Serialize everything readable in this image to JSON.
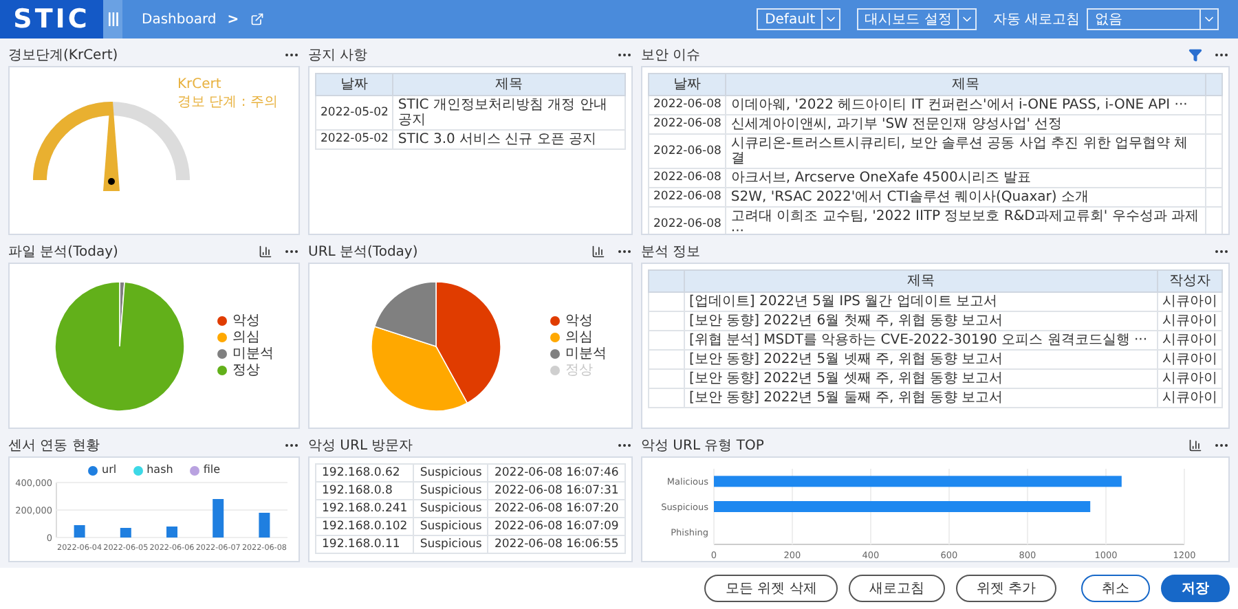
{
  "header": {
    "logo": "STIC",
    "breadcrumb": "Dashboard",
    "separator": ">",
    "dashboard_select": "Default",
    "settings_menu": "대시보드 설정",
    "auto_refresh_label": "자동 새로고침",
    "auto_refresh_select": "없음"
  },
  "panels": [
    {
      "kind": "gauge",
      "title": "경보단계(KrCert)",
      "source": "KrCert",
      "status": "경보 단계 : 주의",
      "level": 0.5
    },
    {
      "kind": "table",
      "title": "공지 사항",
      "columns": [
        "날짜",
        "제목"
      ],
      "rows": [
        [
          "2022-05-02",
          "STIC 개인정보처리방침 개정 안내 공지"
        ],
        [
          "2022-05-02",
          "STIC 3.0 서비스 신규 오픈 공지"
        ]
      ]
    },
    {
      "kind": "table",
      "title": "보안 이슈",
      "filter": true,
      "columns": [
        "날짜",
        "제목",
        ""
      ],
      "rows": [
        [
          "2022-06-08",
          "이데아웨, '2022 헤드아이티 IT 컨퍼런스'에서 i-ONE PASS, i-ONE API ···",
          ""
        ],
        [
          "2022-06-08",
          "신세계아이앤씨, 과기부 'SW 전문인재 양성사업' 선정",
          ""
        ],
        [
          "2022-06-08",
          "시큐리온-트러스트시큐리티, 보안 솔루션 공동 사업 추진 위한 업무협약 체결",
          ""
        ],
        [
          "2022-06-08",
          "아크서브, Arcserve OneXafe 4500시리즈 발표",
          ""
        ],
        [
          "2022-06-08",
          "S2W, 'RSAC 2022'에서 CTI솔루션 퀘이사(Quaxar) 소개",
          ""
        ],
        [
          "2022-06-08",
          "고려대 이희조 교수팀, '2022 IITP 정보보호 R&D과제교류회' 우수성과 과제···",
          ""
        ]
      ]
    },
    {
      "kind": "pie",
      "title": "파일 분석(Today)",
      "chart_toggle": true,
      "legend": [
        {
          "label": "악성",
          "color": "#e03c00",
          "hidden": false
        },
        {
          "label": "의심",
          "color": "#ffa800",
          "hidden": false
        },
        {
          "label": "미분석",
          "color": "#808080",
          "hidden": false
        },
        {
          "label": "정상",
          "color": "#62b01a",
          "hidden": false
        }
      ]
    },
    {
      "kind": "pie",
      "title": "URL 분석(Today)",
      "chart_toggle": true,
      "legend": [
        {
          "label": "악성",
          "color": "#e03c00",
          "hidden": false
        },
        {
          "label": "의심",
          "color": "#ffa800",
          "hidden": false
        },
        {
          "label": "미분석",
          "color": "#808080",
          "hidden": false
        },
        {
          "label": "정상",
          "color": "#cfcfcf",
          "hidden": true
        }
      ]
    },
    {
      "kind": "table",
      "title": "분석 정보",
      "columns": [
        "",
        "제목",
        "작성자"
      ],
      "rows": [
        [
          "",
          "[업데이트] 2022년 5월 IPS 월간 업데이트 보고서",
          "시큐아이"
        ],
        [
          "",
          "[보안 동향] 2022년 6월 첫째 주, 위협 동향 보고서",
          "시큐아이"
        ],
        [
          "",
          "[위협 분석] MSDT를 악용하는 CVE-2022-30190 오피스 원격코드실행 ···",
          "시큐아이"
        ],
        [
          "",
          "[보안 동향] 2022년 5월 넷째 주, 위협 동향 보고서",
          "시큐아이"
        ],
        [
          "",
          "[보안 동향] 2022년 5월 셋째 주, 위협 동향 보고서",
          "시큐아이"
        ],
        [
          "",
          "[보안 동향] 2022년 5월 둘째 주, 위협 동향 보고서",
          "시큐아이"
        ]
      ]
    },
    {
      "kind": "chart",
      "title": "센서 연동 현황",
      "chart_data": {
        "type": "bar",
        "orientation": "vertical",
        "grid": true,
        "categories": [
          "2022-06-04",
          "2022-06-05",
          "2022-06-06",
          "2022-06-07",
          "2022-06-08"
        ],
        "series": [
          {
            "name": "url",
            "color": "#1f7fe0",
            "values": [
              90000,
              70000,
              80000,
              280000,
              180000
            ]
          },
          {
            "name": "hash",
            "color": "#3dd8e6",
            "values": [
              null,
              null,
              null,
              null,
              null
            ]
          },
          {
            "name": "file",
            "color": "#b9a2e0",
            "values": [
              null,
              null,
              null,
              null,
              null
            ]
          }
        ],
        "ylim": [
          0,
          400000
        ],
        "yticks": [
          0,
          {
            "value": 200000,
            "label": "200,000"
          },
          {
            "value": 400000,
            "label": "400,000"
          }
        ]
      }
    },
    {
      "kind": "list",
      "title": "악성 URL 방문자",
      "rows": [
        [
          "192.168.0.62",
          "Suspicious",
          "2022-06-08 16:07:46"
        ],
        [
          "192.168.0.8",
          "Suspicious",
          "2022-06-08 16:07:31"
        ],
        [
          "192.168.0.241",
          "Suspicious",
          "2022-06-08 16:07:20"
        ],
        [
          "192.168.0.102",
          "Suspicious",
          "2022-06-08 16:07:09"
        ],
        [
          "192.168.0.11",
          "Suspicious",
          "2022-06-08 16:06:55"
        ]
      ]
    },
    {
      "kind": "chart",
      "title": "악성 URL 유형 TOP",
      "chart_toggle": true,
      "chart_data": {
        "type": "bar",
        "orientation": "horizontal",
        "grid": true,
        "categories": [
          "Malicious",
          "Suspicious",
          "Phishing"
        ],
        "series": [
          {
            "color": "#1e88f0",
            "values": [
              1040,
              960,
              0
            ]
          }
        ],
        "xlim": [
          0,
          1200
        ],
        "xticks": [
          0,
          200,
          400,
          600,
          800,
          1000,
          1200
        ]
      }
    }
  ],
  "footer": [
    {
      "label": "모든 위젯 삭제",
      "kind": "widget"
    },
    {
      "label": "새로고침",
      "kind": "widget"
    },
    {
      "label": "위젯 추가",
      "kind": "widget"
    },
    {
      "label": "취소",
      "kind": "cancel"
    },
    {
      "label": "저장",
      "kind": "save"
    }
  ]
}
